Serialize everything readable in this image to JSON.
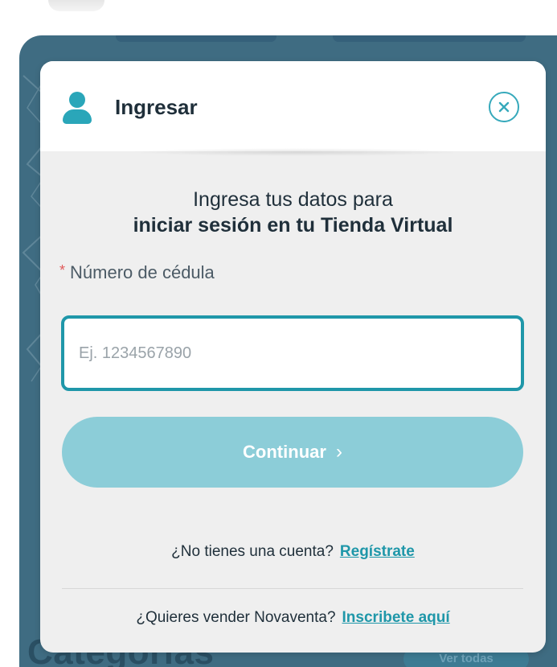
{
  "background": {
    "section_title": "Categorías",
    "ver_todas_label": "Ver todas"
  },
  "modal": {
    "title": "Ingresar",
    "intro_line1": "Ingresa tus datos para",
    "intro_line2": "iniciar sesión en tu Tienda Virtual",
    "field": {
      "required_marker": "*",
      "label": "Número de cédula",
      "value": "",
      "placeholder": "Ej. 1234567890"
    },
    "continue_label": "Continuar",
    "continue_chevron": "›",
    "signup": {
      "text": "¿No tienes una cuenta?",
      "link": "Regístrate"
    },
    "sell": {
      "text": "¿Quieres vender Novaventa?",
      "link": "Inscribete aquí"
    }
  },
  "icons": {
    "user": "user-icon",
    "close": "close-icon",
    "chevron": "chevron-right-icon"
  },
  "colors": {
    "accent": "#2aa6b9",
    "input_border": "#1f97a9",
    "button_disabled": "#8ccdd8",
    "required": "#e05a5a",
    "backdrop": "#3f6c82"
  }
}
